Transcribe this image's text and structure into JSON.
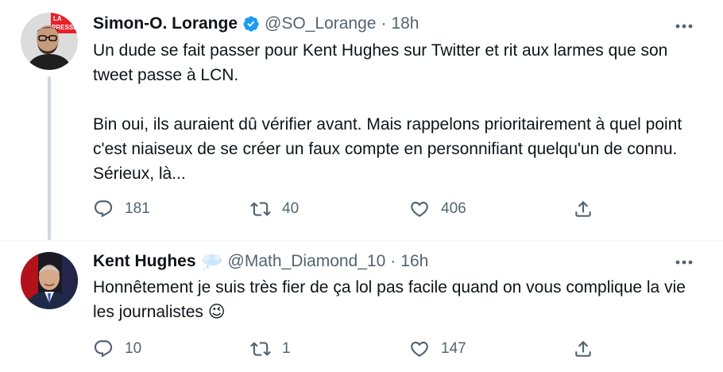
{
  "tweets": [
    {
      "author_name": "Simon-O. Lorange",
      "verified": true,
      "handle": "@SO_Lorange",
      "separator": "·",
      "time": "18h",
      "avatar_badge": "LA PRESSE",
      "text": "Un dude se fait passer pour Kent Hughes sur Twitter et rit aux larmes que son tweet passe à LCN.\n\nBin oui, ils auraient dû vérifier avant. Mais rappelons prioritairement à quel point c'est niaiseux de se créer un faux compte en personnifiant quelqu'un de connu. Sérieux, là...",
      "replies": "181",
      "retweets": "40",
      "likes": "406"
    },
    {
      "author_name": "Kent Hughes",
      "verified": false,
      "handle": "@Math_Diamond_10",
      "separator": "·",
      "time": "16h",
      "name_emoji": "speech-balloon-icon",
      "text": "Honnêtement je suis très fier de ça lol pas facile quand on vous complique la vie les journalistes 😉",
      "replies": "10",
      "retweets": "1",
      "likes": "147"
    }
  ],
  "colors": {
    "text": "#0f1419",
    "muted": "#536471",
    "verified": "#1d9bf0",
    "thread_line": "#cfd9de",
    "divider": "#eff3f4"
  },
  "icons": [
    "more-icon",
    "verified-badge-icon",
    "reply-icon",
    "retweet-icon",
    "like-icon",
    "share-icon"
  ]
}
